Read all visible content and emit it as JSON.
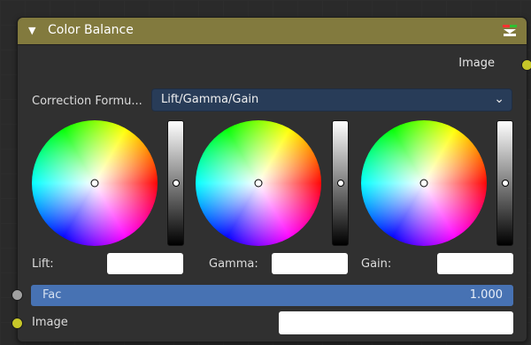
{
  "node": {
    "title": "Color Balance",
    "output_label": "Image",
    "correction_formula_label": "Correction Formu...",
    "correction_formula_value": "Lift/Gamma/Gain",
    "wheels": [
      {
        "label": "Lift:"
      },
      {
        "label": "Gamma:"
      },
      {
        "label": "Gain:"
      }
    ],
    "fac": {
      "label": "Fac",
      "value": "1.000"
    },
    "input_image_label": "Image"
  },
  "colors": {
    "header": "#827a3e",
    "body": "#303030",
    "dropdown": "#283c58",
    "fac_bar": "#4772b3",
    "socket_image": "#c7c729",
    "socket_value": "#a1a1a1"
  },
  "icons": [
    "collapse-arrow-icon",
    "node-color-icon",
    "chevron-down-icon"
  ]
}
